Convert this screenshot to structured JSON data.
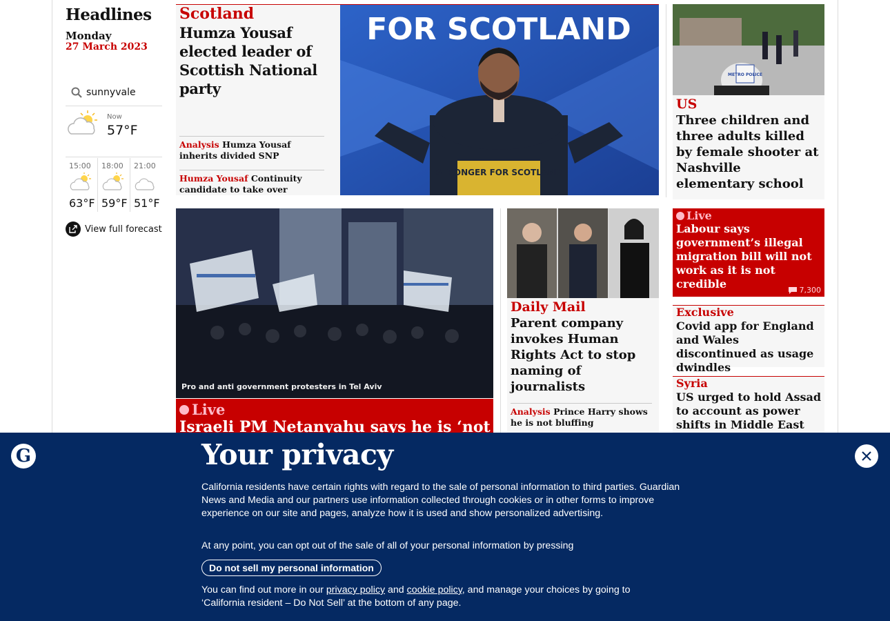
{
  "sidebar": {
    "title": "Headlines",
    "day": "Monday",
    "date": "27 March 2023",
    "search_value": "sunnyvale",
    "now_label": "Now",
    "now_temp": "57°F",
    "forecast": [
      {
        "time": "15:00",
        "temp": "63°F",
        "icon": "sun-cloud-icon"
      },
      {
        "time": "18:00",
        "temp": "59°F",
        "icon": "sun-cloud-icon"
      },
      {
        "time": "21:00",
        "temp": "51°F",
        "icon": "cloud-icon"
      }
    ],
    "full_forecast": "View full forecast"
  },
  "main_story": {
    "kicker": "Scotland",
    "headline": "Humza Yousaf elected leader of Scottish National party",
    "sublinks": [
      {
        "kicker": "Analysis",
        "text": "Humza Yousaf inherits divided SNP"
      },
      {
        "kicker": "Humza Yousaf",
        "text": "Continuity candidate to take over"
      }
    ],
    "image_banner": "FOR SCOTLAND",
    "image_podium": "STRONGER FOR SCOTLAND"
  },
  "us_story": {
    "kicker": "US",
    "headline": "Three children and three adults killed by female shooter at Nashville elementary school",
    "image_text": "METRO POLICE"
  },
  "israel_story": {
    "caption": "Pro and anti government protesters in Tel Aviv",
    "live": "Live",
    "headline": "Israeli PM Netanyahu says he is ‘not"
  },
  "mail_story": {
    "kicker": "Daily Mail",
    "headline": "Parent company invokes Human Rights Act to stop naming of journalists",
    "sublink_kicker": "Analysis",
    "sublink_text": "Prince Harry shows he is not bluffing"
  },
  "labour_story": {
    "live": "Live",
    "headline": "Labour says government’s illegal migration bill will not work as it is not credible",
    "comments": "7,300"
  },
  "covid_story": {
    "kicker": "Exclusive",
    "headline": "Covid app for England and Wales discontinued as usage dwindles"
  },
  "syria_story": {
    "kicker": "Syria",
    "headline": "US urged to hold Assad to account as power shifts in Middle East"
  },
  "privacy": {
    "title": "Your privacy",
    "body": "California residents have certain rights with regard to the sale of personal information to third parties. Guardian News and Media and our partners use information collected through cookies or in other forms to improve experience on our site and pages, analyze how it is used and show personalized advertising.",
    "optout": "At any point, you can opt out of the sale of all of your personal information by pressing",
    "button": "Do not sell my personal information",
    "more_prefix": "You can find out more in our",
    "privacy_link": "privacy policy",
    "and": "and",
    "cookie_link": "cookie policy",
    "more_suffix": ", and manage your choices by going to ‘California resident – Do Not Sell’ at the bottom of any page."
  },
  "colors": {
    "brand_red": "#c70000",
    "brand_blue": "#052962"
  }
}
